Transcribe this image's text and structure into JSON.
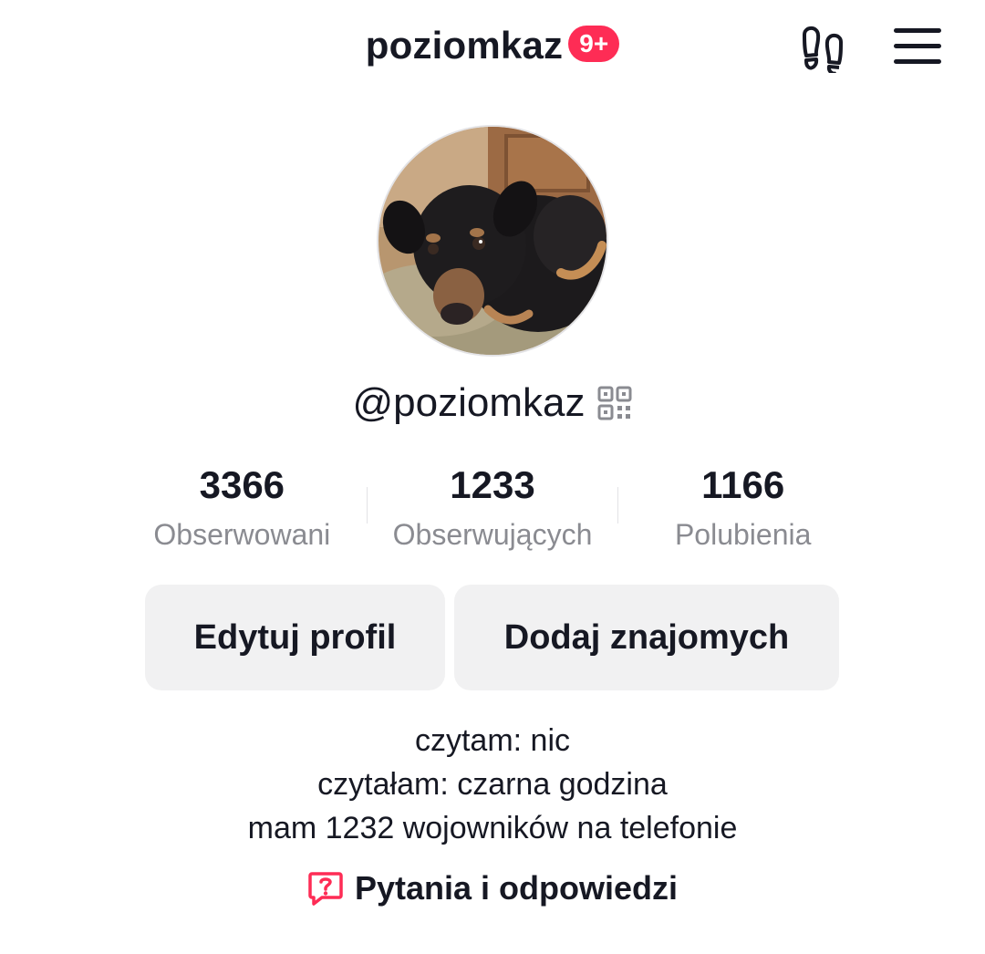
{
  "header": {
    "username": "poziomkaz",
    "notification_badge": "9+",
    "footprint_icon": "footprints-icon",
    "menu_icon": "hamburger-menu-icon"
  },
  "profile": {
    "avatar_icon": "dog-profile-photo",
    "handle": "@poziomkaz",
    "qr_icon": "qr-code-icon"
  },
  "stats": [
    {
      "value": "3366",
      "label": "Obserwowani"
    },
    {
      "value": "1233",
      "label": "Obserwujących"
    },
    {
      "value": "1166",
      "label": "Polubienia"
    }
  ],
  "actions": {
    "edit_label": "Edytuj profil",
    "add_friends_label": "Dodaj znajomych"
  },
  "bio": [
    "czytam: nic",
    "czytałam: czarna godzina",
    "mam 1232 wojowników na telefonie"
  ],
  "qa": {
    "icon": "question-bubble-icon",
    "label": "Pytania i odpowiedzi"
  },
  "colors": {
    "accent": "#fe2c55",
    "text": "#161823",
    "muted": "#8a8b91",
    "button_bg": "#f1f1f2"
  }
}
